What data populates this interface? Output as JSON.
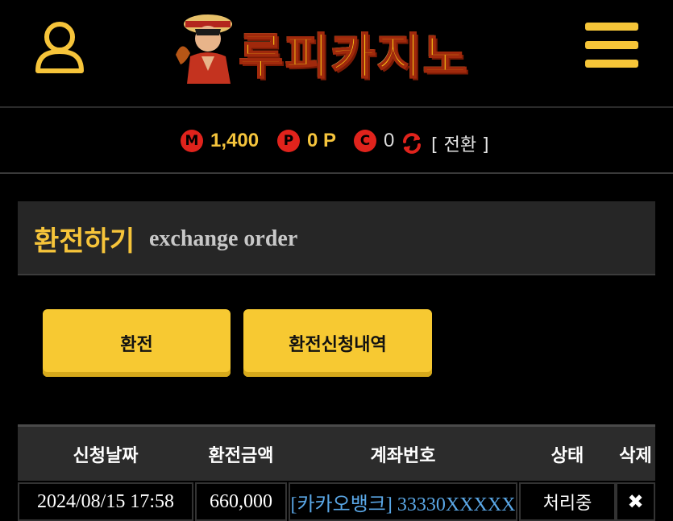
{
  "header": {
    "logo_text": "루피카지노",
    "user_icon": "user-icon",
    "menu_icon": "hamburger-menu-icon"
  },
  "balance": {
    "money_badge": "M",
    "money_value": "1,400",
    "point_badge": "P",
    "point_value": "0 P",
    "coupon_badge": "C",
    "coupon_value": "0",
    "convert_label": "[ 전환 ]",
    "convert_icon": "refresh-icon"
  },
  "title": {
    "ko": "환전하기",
    "en": "exchange order"
  },
  "actions": {
    "exchange": "환전",
    "history": "환전신청내역"
  },
  "table": {
    "headers": [
      "신청날짜",
      "환전금액",
      "계좌번호",
      "상태",
      "삭제"
    ],
    "rows": [
      {
        "date": "2024/08/15 17:58",
        "amount": "660,000",
        "account": "[카카오뱅크] 33330XXXXX",
        "status": "처리중",
        "delete": "✖"
      }
    ]
  },
  "colors": {
    "accent": "#f6c43a",
    "badge": "#e0231c",
    "link": "#5aa7e6"
  }
}
